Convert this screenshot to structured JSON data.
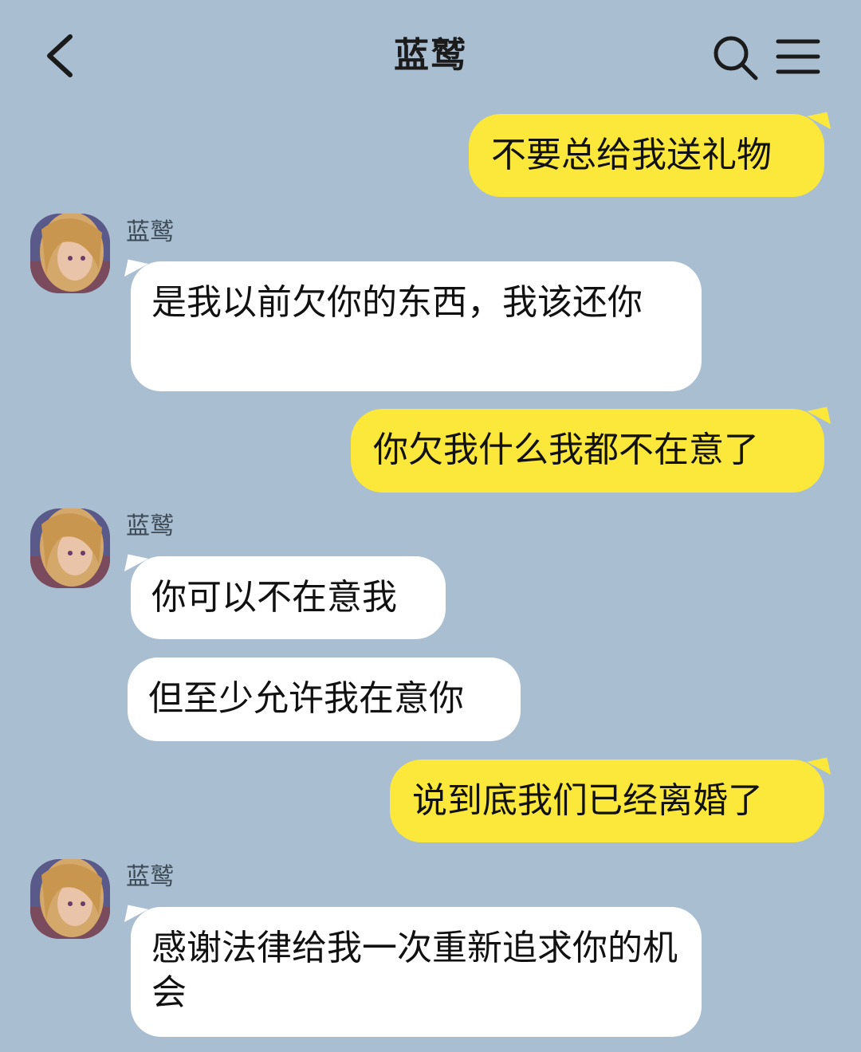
{
  "header": {
    "title": "蓝鹫",
    "back_icon": "chevron-left-icon",
    "search_icon": "search-icon",
    "menu_icon": "hamburger-menu-icon"
  },
  "colors": {
    "background": "#a9bfd1",
    "outgoing_bubble": "#fbe83a",
    "incoming_bubble": "#ffffff"
  },
  "messages": [
    {
      "side": "right",
      "text": "不要总给我送礼物"
    },
    {
      "side": "left",
      "sender": "蓝鹫",
      "text": "是我以前欠你的东西，我该还你"
    },
    {
      "side": "right",
      "text": "你欠我什么我都不在意了"
    },
    {
      "side": "left",
      "sender": "蓝鹫",
      "text": "你可以不在意我"
    },
    {
      "side": "left",
      "text": "但至少允许我在意你"
    },
    {
      "side": "right",
      "text": "说到底我们已经离婚了"
    },
    {
      "side": "left",
      "sender": "蓝鹫",
      "text": "感谢法律给我一次重新追求你的机会"
    }
  ]
}
